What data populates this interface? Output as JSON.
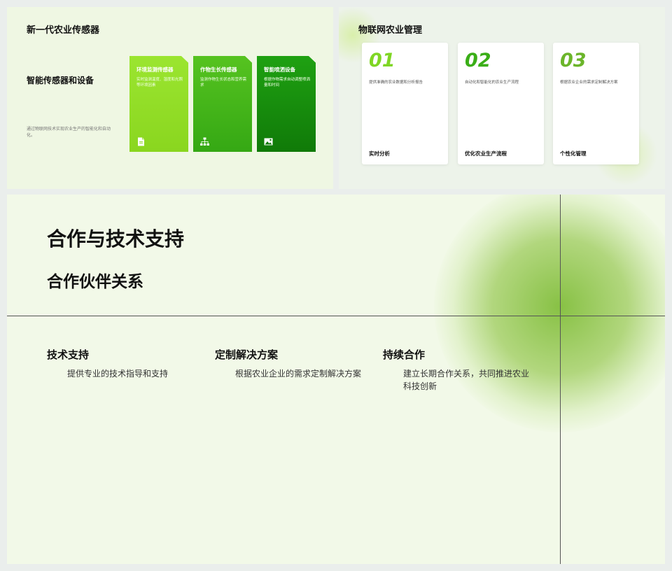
{
  "slide1": {
    "title": "新一代农业传感器",
    "subtitle": "智能传感器和设备",
    "description": "通过物联网技术实现农业生产的智能化和自动化。",
    "cards": [
      {
        "title": "环境监测传感器",
        "description": "实时监测温度、湿度和光照等环境因素",
        "icon": "document-icon"
      },
      {
        "title": "作物生长传感器",
        "description": "监测作物生长状态和营养需求",
        "icon": "hierarchy-icon"
      },
      {
        "title": "智能喷洒设备",
        "description": "根据作物需求自动调整喷洒量和时间",
        "icon": "image-icon"
      }
    ],
    "colors": {
      "card1": "#8ad61f",
      "card2": "#35a814",
      "card3": "#107a08"
    }
  },
  "slide2": {
    "title": "物联网农业管理",
    "cards": [
      {
        "number": "01",
        "description": "提供准确的农业数据和分析报告",
        "label": "实时分析"
      },
      {
        "number": "02",
        "description": "自动化和智能化的农业生产流程",
        "label": "优化农业生产流程"
      },
      {
        "number": "03",
        "description": "根据农业企业的需求定制解决方案",
        "label": "个性化管理"
      }
    ]
  },
  "slide3": {
    "title": "合作与技术支持",
    "subtitle": "合作伙伴关系",
    "columns": [
      {
        "title": "技术支持",
        "description": "提供专业的技术指导和支持"
      },
      {
        "title": "定制解决方案",
        "description": "根据农业企业的需求定制解决方案"
      },
      {
        "title": "持续合作",
        "description": "建立长期合作关系，共同推进农业科技创新"
      }
    ]
  }
}
